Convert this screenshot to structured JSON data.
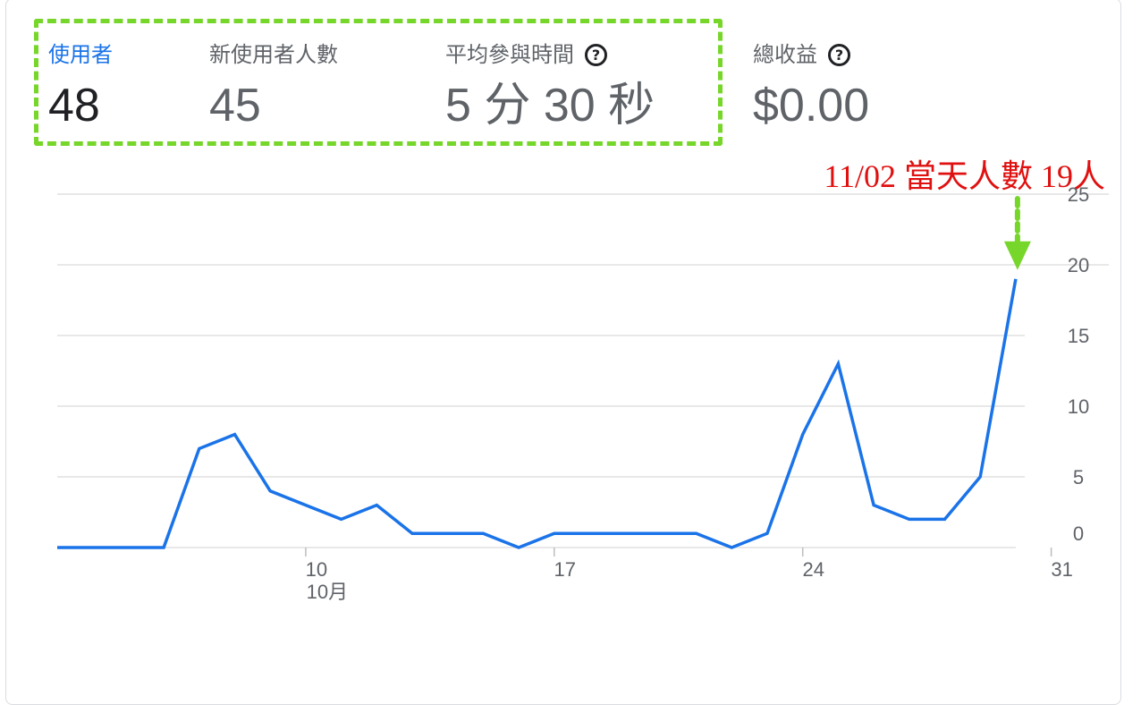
{
  "metrics": [
    {
      "label": "使用者",
      "value": "48",
      "active": true
    },
    {
      "label": "新使用者人數",
      "value": "45"
    },
    {
      "label": "平均參與時間",
      "value": "5 分 30 秒",
      "help": "?"
    },
    {
      "label": "總收益",
      "value": "$0.00",
      "help": "?"
    }
  ],
  "annotation": "11/02 當天人數 19人",
  "colors": {
    "line": "#1a73e8",
    "grid": "#e0e0e0",
    "highlight": "#76d62a",
    "annotation": "#e01010",
    "active_label": "#1a73e8"
  },
  "chart_data": {
    "type": "line",
    "x": [
      "10/03",
      "10/04",
      "10/05",
      "10/06",
      "10/07",
      "10/08",
      "10/09",
      "10/10",
      "10/11",
      "10/12",
      "10/13",
      "10/14",
      "10/15",
      "10/16",
      "10/17",
      "10/18",
      "10/19",
      "10/20",
      "10/21",
      "10/22",
      "10/23",
      "10/24",
      "10/25",
      "10/26",
      "10/27",
      "10/28",
      "10/29",
      "10/30",
      "10/31",
      "11/01",
      "11/02"
    ],
    "series": [
      {
        "values": [
          0,
          0,
          0,
          0,
          7,
          8,
          4,
          3,
          2,
          3,
          1,
          1,
          1,
          0,
          1,
          1,
          1,
          1,
          1,
          0,
          1,
          8,
          13,
          3,
          2,
          2,
          5,
          19
        ]
      }
    ],
    "x_tick_labels": [
      {
        "date": "10/10",
        "label": "10",
        "sublabel": "10月"
      },
      {
        "date": "10/17",
        "label": "17"
      },
      {
        "date": "10/24",
        "label": "24"
      },
      {
        "date": "10/31",
        "label": "31"
      }
    ],
    "y_ticks": [
      0,
      5,
      10,
      15,
      20,
      25
    ],
    "ylim": [
      0,
      25
    ],
    "y_axis_position": "right",
    "grid": true
  }
}
